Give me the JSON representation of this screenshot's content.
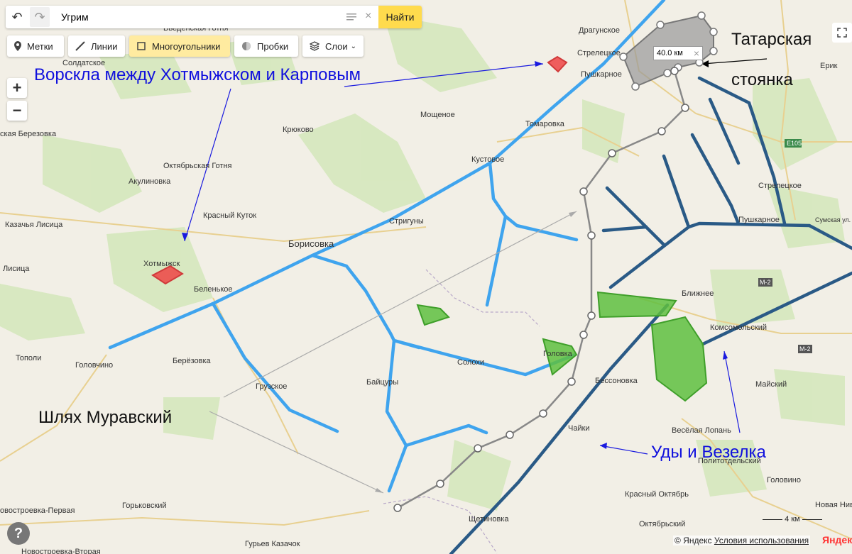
{
  "search": {
    "value": "Угрим",
    "button": "Найти"
  },
  "toolbar": {
    "marks": "Метки",
    "lines": "Линии",
    "polygons": "Многоугольники",
    "traffic": "Пробки",
    "layers": "Слои"
  },
  "controls": {
    "zoom_in": "+",
    "zoom_out": "−",
    "help": "?"
  },
  "distance_label": "40.0 км",
  "annotations": {
    "vorskla": "Ворскла между Хотмыжском и Карповым",
    "tatar1": "Татарская",
    "tatar2": "стоянка",
    "shlyah": "Шлях Муравский",
    "udy": "Уды и Везелка"
  },
  "places": [
    "Солдатское",
    "Введенская Готня",
    "Драгунское",
    "Стрелецкое",
    "Пушкарное",
    "Мощеное",
    "Томаровка",
    "Крюково",
    "ская Березовка",
    "Октябрьская Готня",
    "Кустовое",
    "Акулиновка",
    "Красный Куток",
    "Стригуны",
    "Стрелецкое",
    "Пушкарное",
    "Казачья Лисица",
    "Борисовка",
    "Хотмыжск",
    "Лисица",
    "Беленькое",
    "Ближнее",
    "Комсомольский",
    "Тополи",
    "Головчино",
    "Берёзовка",
    "Грузское",
    "Байцуры",
    "Солохи",
    "Головка",
    "Бессоновка",
    "Майский",
    "Весёлая Лопань",
    "Чайки",
    "Политотдельский",
    "Головино",
    "Красный Октябрь",
    "Новая Ниве",
    "овостроевка-Первая",
    "Горьковский",
    "Щетиновка",
    "Октябрьский",
    "Гурьев Казачок",
    "Новостроевка-Вторая",
    "Ерик",
    "Сумская ул.",
    "Мощеное"
  ],
  "road_labels": [
    "E105",
    "M-2",
    "M-2"
  ],
  "scale_label": "4 км",
  "copyright": {
    "text": "© Яндекс",
    "link": "Условия использования"
  },
  "logo": "Яндекс",
  "colors": {
    "river": "#3fa4ee",
    "road": "#2a5a86",
    "polygon_green": "#5fbf3f",
    "polygon_red": "#ee4444",
    "route": "#888888",
    "annotation": "#1010dd"
  }
}
